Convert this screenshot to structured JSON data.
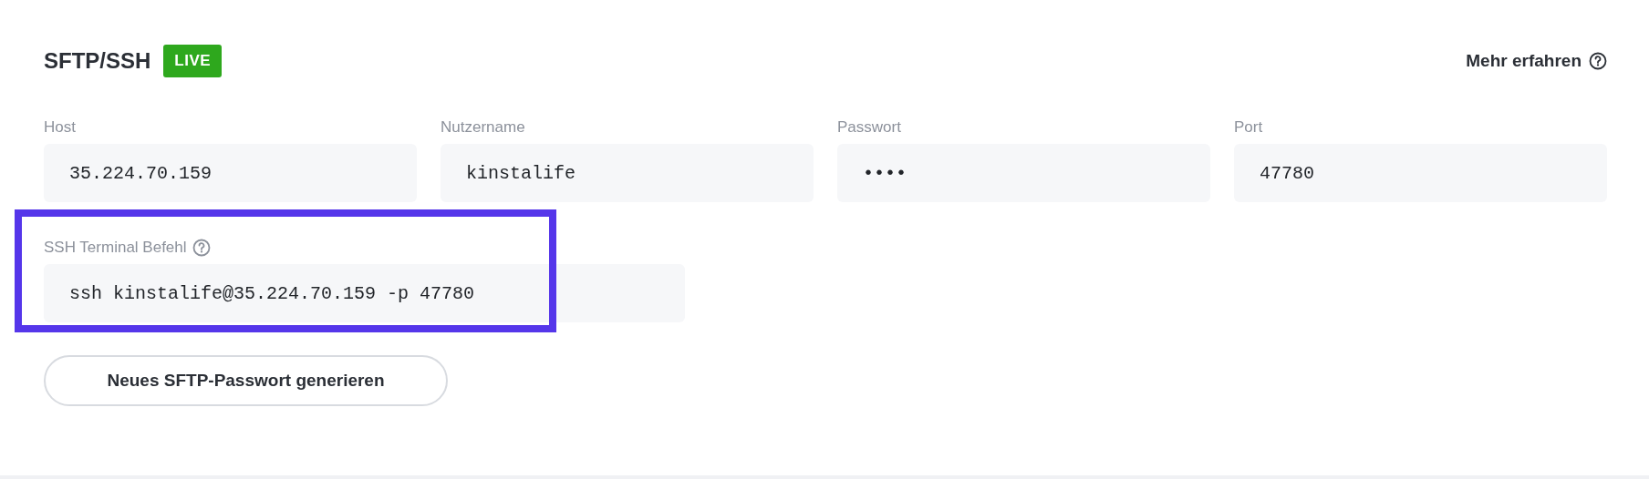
{
  "header": {
    "title": "SFTP/SSH",
    "status_badge": "LIVE",
    "help_link": "Mehr erfahren"
  },
  "fields": [
    {
      "label": "Host",
      "value": "35.224.70.159"
    },
    {
      "label": "Nutzername",
      "value": "kinstalife"
    },
    {
      "label": "Passwort",
      "value": "••••"
    },
    {
      "label": "Port",
      "value": "47780"
    }
  ],
  "ssh_command": {
    "label": "SSH Terminal Befehl",
    "value": "ssh kinstalife@35.224.70.159 -p 47780",
    "highlighted": true
  },
  "buttons": [
    "Neues SFTP-Passwort generieren"
  ]
}
